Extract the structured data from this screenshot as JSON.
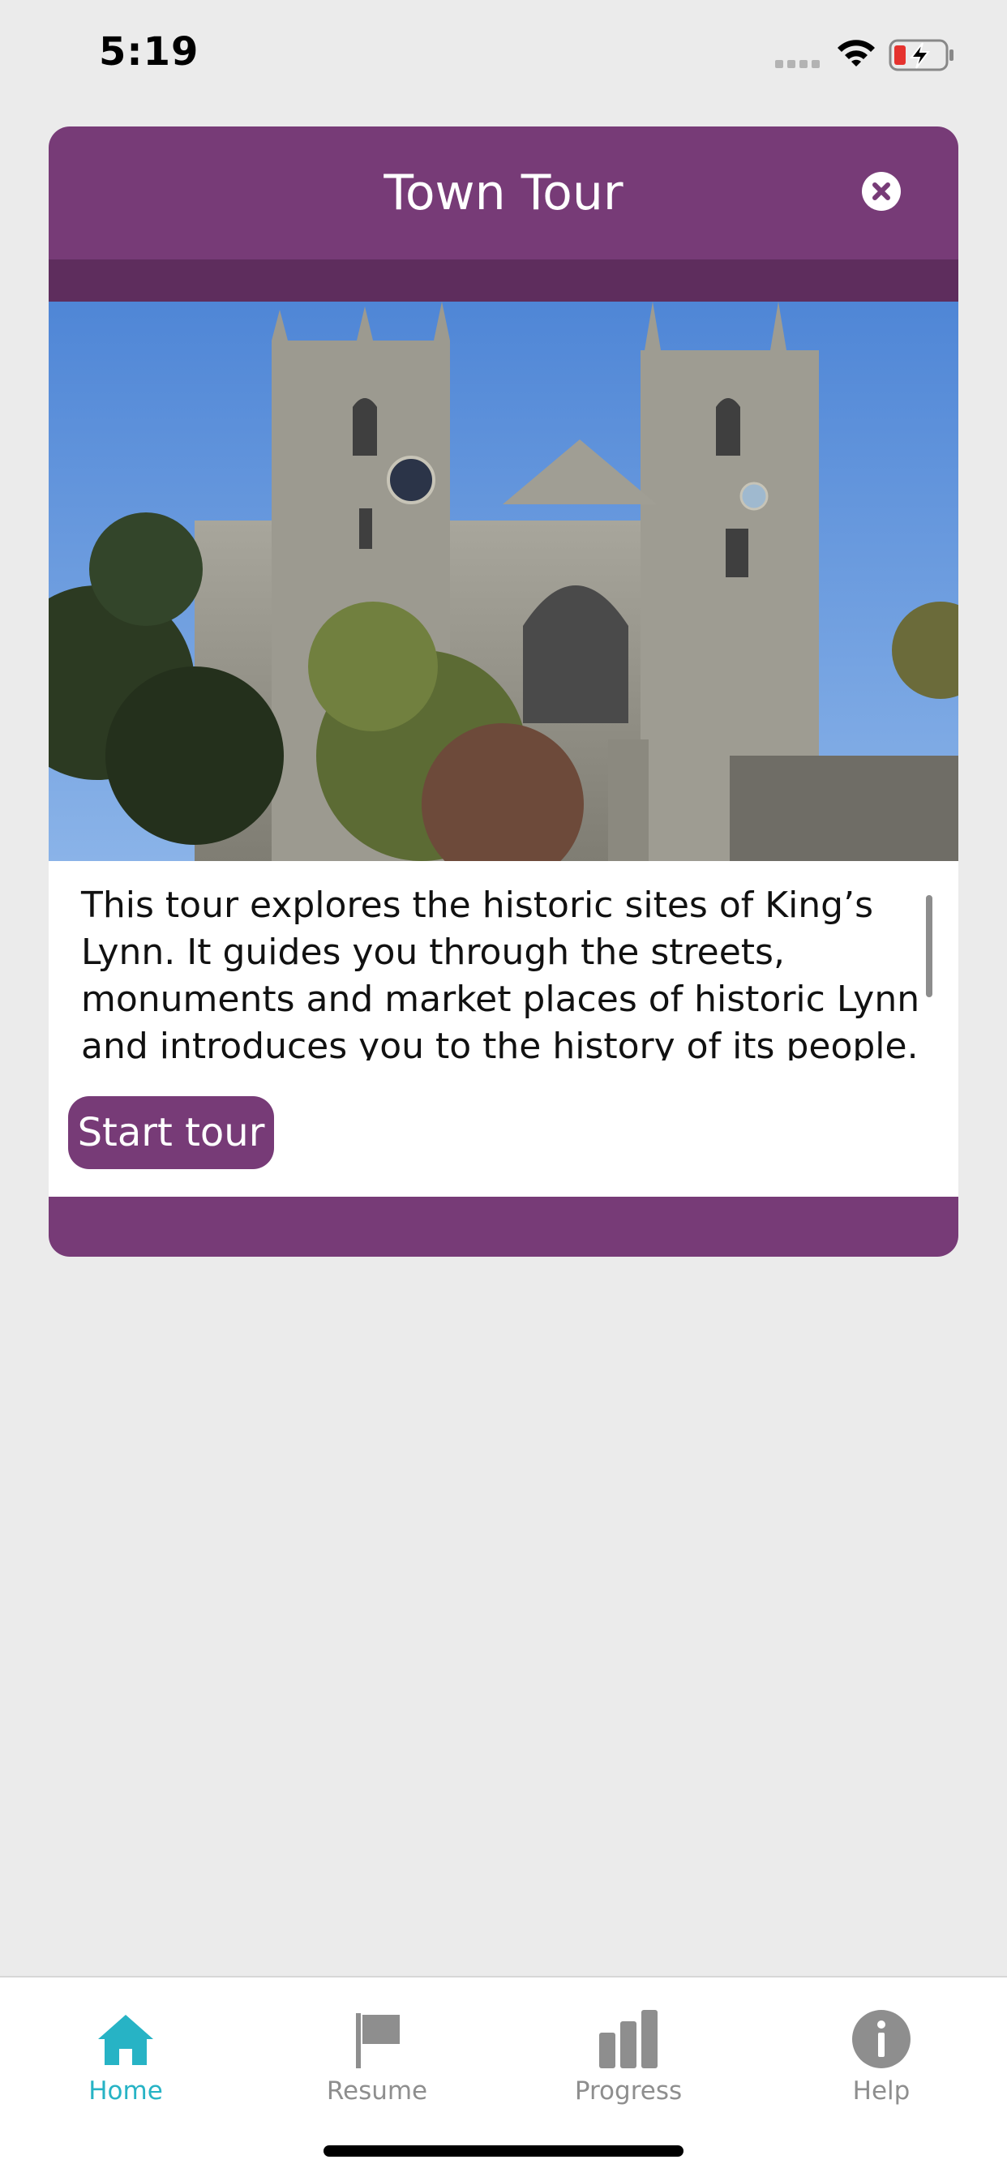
{
  "status_bar": {
    "time": "5:19",
    "signal_icon": "cellular-signal-icon",
    "wifi_icon": "wifi-icon",
    "battery_icon": "battery-charging-icon"
  },
  "modal": {
    "title": "Town Tour",
    "close_icon": "close-circle-icon",
    "image_subject": "cathedral-photo",
    "description": "This tour explores the historic sites of King’s Lynn. It guides you through the streets, monuments and market places of historic Lynn and introduces you to the history of its people.",
    "start_button_label": "Start tour"
  },
  "tab_bar": {
    "tabs": [
      {
        "label": "Home",
        "icon": "home-icon",
        "active": true
      },
      {
        "label": "Resume",
        "icon": "flag-icon",
        "active": false
      },
      {
        "label": "Progress",
        "icon": "bar-chart-icon",
        "active": false
      },
      {
        "label": "Help",
        "icon": "info-icon",
        "active": false
      }
    ]
  },
  "colors": {
    "brand_purple": "#773b77",
    "brand_purple_dark": "#5e2d5d",
    "tab_active": "#27b3c5",
    "tab_inactive": "#8e8e8e",
    "background": "#ebebeb"
  }
}
